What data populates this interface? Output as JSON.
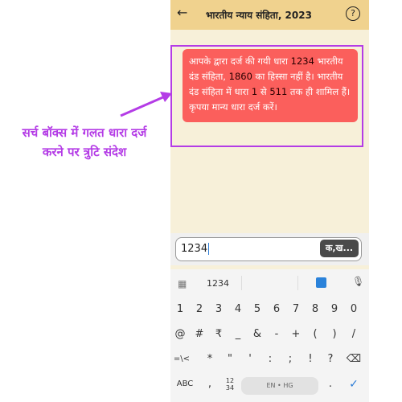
{
  "annotation": {
    "line1": "सर्च बॉक्स में गलत धारा दर्ज",
    "line2": "करने पर त्रुटि संदेश"
  },
  "appbar": {
    "back_icon": "arrow-left-icon",
    "title": "भारतीय न्याय संहिता, 2023",
    "help_icon": "help-circle-icon"
  },
  "error_message": {
    "part1": "आपके द्वारा दर्ज की गयी धारा ",
    "num1": "1234",
    "part2": " भारतीय दंड संहिता, ",
    "num2": "1860",
    "part3": " का हिस्सा नहीं है। भारतीय दंड संहिता में धारा ",
    "num3": "1",
    "part4": " से ",
    "num4": "511",
    "part5": " तक ही शामिल हैं। कृपया मान्य धारा दर्ज करें।"
  },
  "search": {
    "value": "1234",
    "button_label": "क,ख..."
  },
  "keyboard": {
    "suggestion": "1234",
    "row_numbers": [
      "1",
      "2",
      "3",
      "4",
      "5",
      "6",
      "7",
      "8",
      "9",
      "0"
    ],
    "row_symbols1": [
      "@",
      "#",
      "₹",
      "_",
      "&",
      "-",
      "+",
      "(",
      ")",
      "/"
    ],
    "row_symbols2": [
      "=\\<",
      "*",
      "\"",
      "'",
      ":",
      ";",
      "!",
      "?",
      "⌫"
    ],
    "bottom": {
      "abc": "ABC",
      "comma": ",",
      "numpad_top": "12",
      "numpad_bottom": "34",
      "space": "EN • HG",
      "period": ".",
      "enter": "✓"
    }
  },
  "colors": {
    "accent": "#b43ce6",
    "appbar": "#f0d28e",
    "error": "#fb5f5c",
    "background": "#f7f0d9"
  }
}
